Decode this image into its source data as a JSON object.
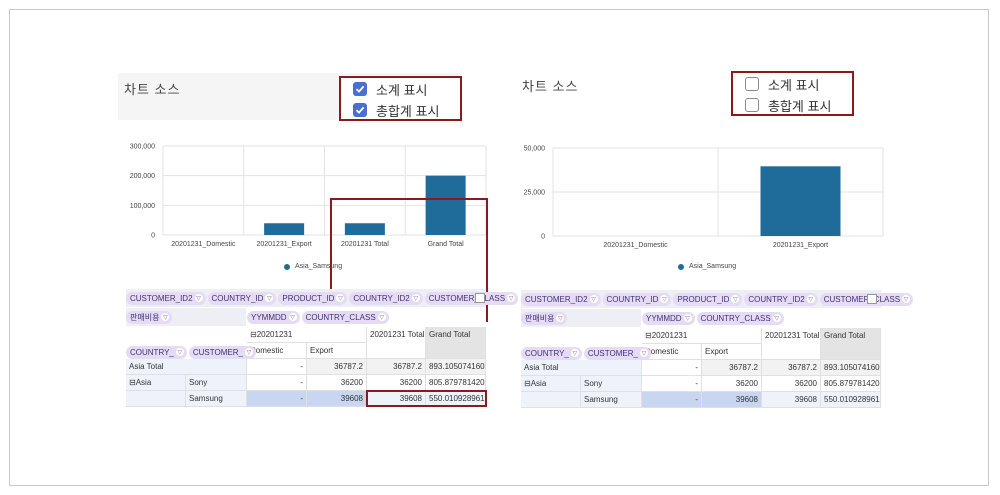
{
  "left": {
    "source_title": "차트 소스",
    "options": [
      {
        "label": "소계 표시",
        "checked": true
      },
      {
        "label": "총합계 표시",
        "checked": true
      }
    ],
    "chart_data": {
      "type": "bar",
      "categories": [
        "20201231_Domestic",
        "20201231_Export",
        "20201231 Total",
        "Grand Total"
      ],
      "series": [
        {
          "name": "Asia_Samsung",
          "values": [
            0,
            39608,
            39608,
            200000
          ]
        }
      ],
      "yticks": [
        "0",
        "100,000",
        "200,000",
        "300,000"
      ],
      "ylim": [
        0,
        300000
      ],
      "legend": "bottom",
      "color": "#1f6b9a"
    },
    "grid": {
      "row_fields": [
        "CUSTOMER_ID2",
        "COUNTRY_ID",
        "PRODUCT_ID",
        "COUNTRY_ID2",
        "CUSTOMER_CLASS"
      ],
      "value_field": "판매비용",
      "col_fields": [
        "YYMMDD",
        "COUNTRY_CLASS"
      ],
      "date_header": "⊟20201231",
      "sub_headers": [
        "Domestic",
        "Export"
      ],
      "total_header": "20201231 Total",
      "grand_header": "Grand Total",
      "row_header_fields": [
        "COUNTRY_",
        "CUSTOMER_"
      ],
      "rows": [
        {
          "c1": "Asia Total",
          "c2": "",
          "domestic": "-",
          "export": "36787.2",
          "total": "36787.2",
          "grand": "893.10507416085"
        },
        {
          "c1": "⊟Asia",
          "c2": "Sony",
          "domestic": "-",
          "export": "36200",
          "total": "36200",
          "grand": "805.87978142078"
        },
        {
          "c1": "",
          "c2": "Samsung",
          "domestic": "-",
          "export": "39608",
          "total": "39608",
          "grand": "550.01092896174"
        }
      ]
    }
  },
  "right": {
    "source_title": "차트 소스",
    "options": [
      {
        "label": "소계 표시",
        "checked": false
      },
      {
        "label": "총합계 표시",
        "checked": false
      }
    ],
    "chart_data": {
      "type": "bar",
      "categories": [
        "20201231_Domestic",
        "20201231_Export"
      ],
      "series": [
        {
          "name": "Asia_Samsung",
          "values": [
            0,
            39608
          ]
        }
      ],
      "yticks": [
        "0",
        "25,000",
        "50,000"
      ],
      "ylim": [
        0,
        50000
      ],
      "legend": "bottom",
      "color": "#1f6b9a"
    },
    "grid": {
      "row_fields": [
        "CUSTOMER_ID2",
        "COUNTRY_ID",
        "PRODUCT_ID",
        "COUNTRY_ID2",
        "CUSTOMER_CLASS"
      ],
      "value_field": "판매비용",
      "col_fields": [
        "YYMMDD",
        "COUNTRY_CLASS"
      ],
      "date_header": "⊟20201231",
      "sub_headers": [
        "Domestic",
        "Export"
      ],
      "total_header": "20201231 Total",
      "grand_header": "Grand Total",
      "row_header_fields": [
        "COUNTRY_",
        "CUSTOMER_"
      ],
      "rows": [
        {
          "c1": "Asia Total",
          "c2": "",
          "domestic": "-",
          "export": "36787.2",
          "total": "36787.2",
          "grand": "893.10507416085"
        },
        {
          "c1": "⊟Asia",
          "c2": "Sony",
          "domestic": "-",
          "export": "36200",
          "total": "36200",
          "grand": "805.87978142078"
        },
        {
          "c1": "",
          "c2": "Samsung",
          "domestic": "-",
          "export": "39608",
          "total": "39608",
          "grand": "550.01092896174"
        }
      ]
    }
  }
}
